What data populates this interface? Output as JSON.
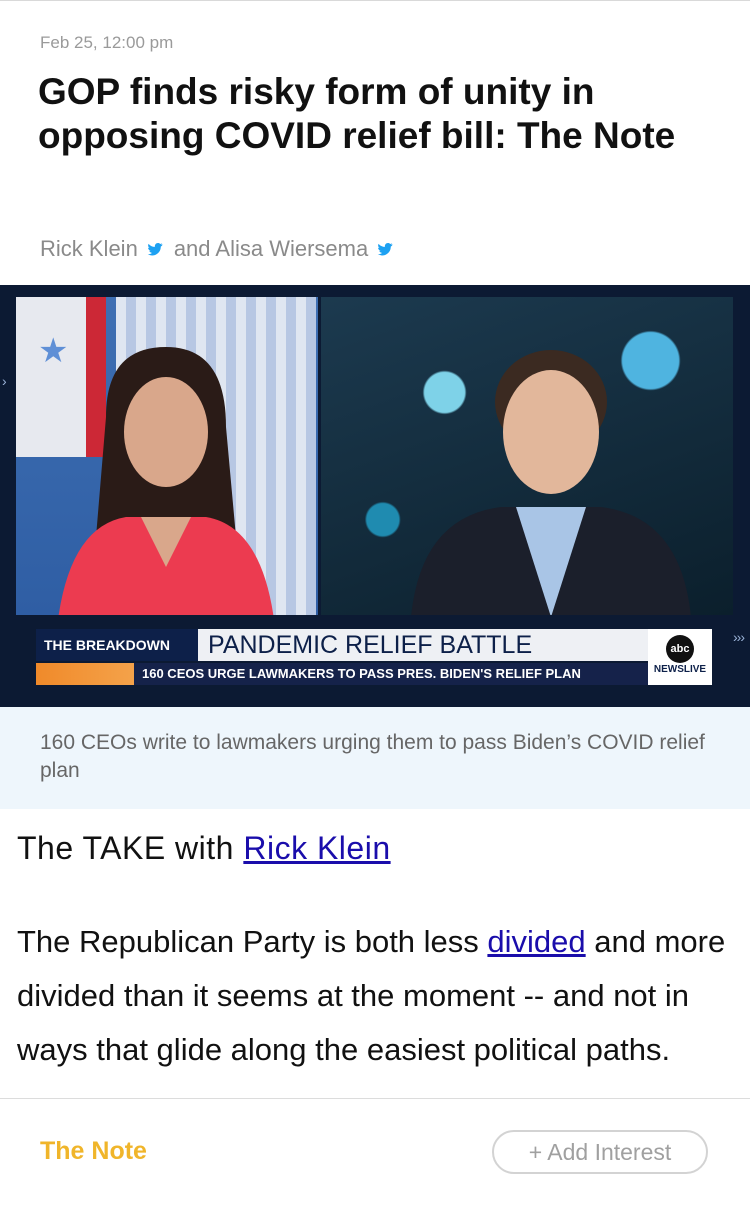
{
  "article": {
    "date": "Feb 25, 12:00 pm",
    "title": "GOP finds risky form of unity in opposing COVID relief bill: The Note",
    "author1": "Rick Klein",
    "and_text": "and Alisa Wiersema",
    "icons": [
      "twitter-icon",
      "twitter-icon"
    ],
    "link_color": "#1a0dab"
  },
  "video": {
    "lower_third_label": "THE BREAKDOWN",
    "lower_third_headline": "PANDEMIC RELIEF BATTLE",
    "lower_third_sub": "160 CEOS URGE LAWMAKERS TO PASS PRES. BIDEN'S RELIEF PLAN",
    "network_logo": "abc",
    "network_label": "NEWSLIVE"
  },
  "caption": {
    "text": "160 CEOs write to lawmakers urging them to pass Biden’s COVID relief plan"
  },
  "take": {
    "prefix": "The TAKE with",
    "link": "Rick Klein"
  },
  "body": {
    "before_link": "The Republican Party is both less ",
    "link": "divided",
    "after_link": " and more divided than it seems at the moment -- and not in ways that glide along the easiest political paths."
  },
  "footer": {
    "section": "The Note",
    "add_interest": "+ Add Interest",
    "accent": "#f0b52a"
  }
}
